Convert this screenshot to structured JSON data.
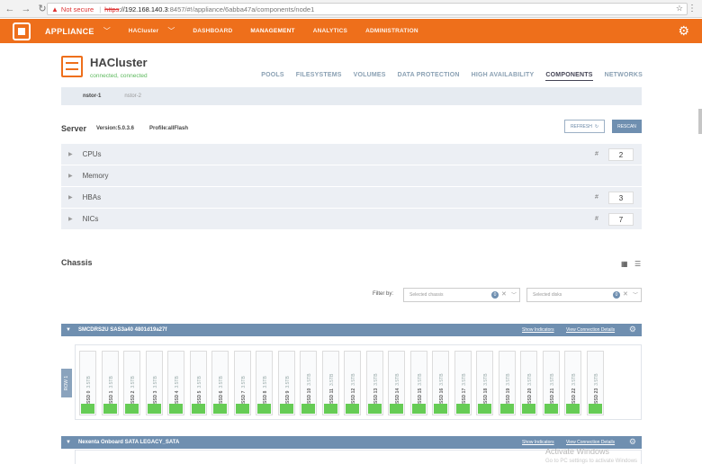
{
  "browser": {
    "back": "←",
    "forward": "→",
    "reload": "↻",
    "not_secure": "Not secure",
    "url_scheme": "https",
    "url_host": "://192.168.140.3",
    "url_path": ":8457/#!/appliance/6abba47a/components/node1",
    "star": "☆",
    "menu": "⋮"
  },
  "app": {
    "brand": "APPLIANCE",
    "cluster_nav": "HACluster",
    "nav": [
      "DASHBOARD",
      "MANAGEMENT",
      "ANALYTICS",
      "ADMINISTRATION"
    ],
    "active_nav": "MANAGEMENT"
  },
  "page": {
    "title": "HACluster",
    "status": "connected, connected",
    "tabs": [
      "POOLS",
      "FILESYSTEMS",
      "VOLUMES",
      "DATA PROTECTION",
      "HIGH AVAILABILITY",
      "COMPONENTS",
      "NETWORKS"
    ],
    "active_tab": "COMPONENTS",
    "subtabs": [
      "nstor-1",
      "nstor-2"
    ]
  },
  "server": {
    "title": "Server",
    "version": "Version:5.0.3.6",
    "profile": "Profile:allFlash",
    "refresh_label": "REFRESH",
    "rescan_label": "RESCAN",
    "components": [
      {
        "label": "CPUs",
        "hash": "#",
        "count": "2"
      },
      {
        "label": "Memory",
        "hash": "",
        "count": ""
      },
      {
        "label": "HBAs",
        "hash": "#",
        "count": "3"
      },
      {
        "label": "NICs",
        "hash": "#",
        "count": "7"
      }
    ]
  },
  "chassis": {
    "title": "Chassis",
    "filter_label": "Filter by:",
    "chassis_placeholder": "Selected chassis",
    "chassis_badge": "0",
    "disks_placeholder": "Selected disks",
    "disks_badge": "0",
    "enclosures": [
      {
        "name": "SMCDRS2U SAS3a40 4801d19a27f",
        "show_indicators": "Show Indicators",
        "view_connection": "View Connection Details"
      },
      {
        "name": "Nexenta Onboard SATA LEGACY_SATA",
        "show_indicators": "Show Indicators",
        "view_connection": "View Connection Details"
      }
    ],
    "row_label": "ROW 1",
    "disks": [
      {
        "slot": "SSD 0",
        "size": "3.5TB"
      },
      {
        "slot": "SSD 1",
        "size": "3.5TB"
      },
      {
        "slot": "SSD 2",
        "size": "3.5TB"
      },
      {
        "slot": "SSD 3",
        "size": "3.5TB"
      },
      {
        "slot": "SSD 4",
        "size": "3.5TB"
      },
      {
        "slot": "SSD 5",
        "size": "3.5TB"
      },
      {
        "slot": "SSD 6",
        "size": "3.5TB"
      },
      {
        "slot": "SSD 7",
        "size": "3.5TB"
      },
      {
        "slot": "SSD 8",
        "size": "3.5TB"
      },
      {
        "slot": "SSD 9",
        "size": "3.5TB"
      },
      {
        "slot": "SSD 10",
        "size": "3.5TB"
      },
      {
        "slot": "SSD 11",
        "size": "3.5TB"
      },
      {
        "slot": "SSD 12",
        "size": "3.5TB"
      },
      {
        "slot": "SSD 13",
        "size": "3.5TB"
      },
      {
        "slot": "SSD 14",
        "size": "3.5TB"
      },
      {
        "slot": "SSD 15",
        "size": "3.5TB"
      },
      {
        "slot": "SSD 16",
        "size": "3.5TB"
      },
      {
        "slot": "SSD 17",
        "size": "3.5TB"
      },
      {
        "slot": "SSD 18",
        "size": "3.5TB"
      },
      {
        "slot": "SSD 19",
        "size": "3.5TB"
      },
      {
        "slot": "SSD 20",
        "size": "3.5TB"
      },
      {
        "slot": "SSD 21",
        "size": "3.5TB"
      },
      {
        "slot": "SSD 22",
        "size": "3.5TB"
      },
      {
        "slot": "SSD 23",
        "size": "3.5TB"
      }
    ]
  },
  "watermark": {
    "title": "Activate Windows",
    "subtitle": "Go to PC settings to activate Windows"
  },
  "colors": {
    "brand_orange": "#ee6f1b",
    "steel_blue": "#6f8fb0",
    "disk_green": "#66cc55",
    "status_green": "#5cb85c"
  }
}
